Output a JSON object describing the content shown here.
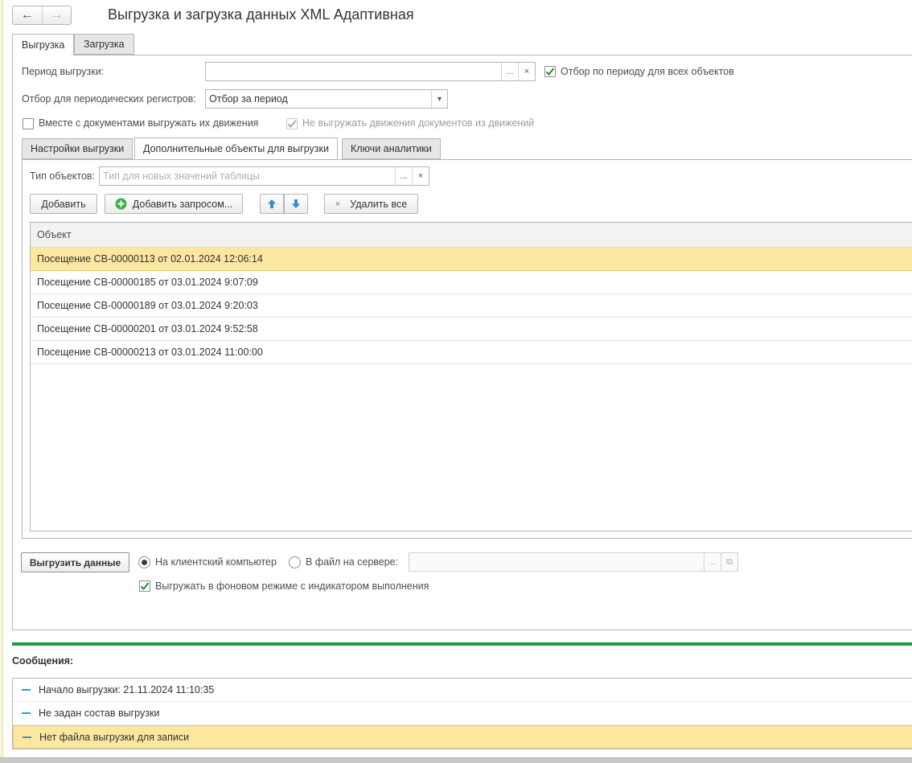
{
  "window": {
    "title": "Выгрузка и загрузка данных XML Адаптивная"
  },
  "nav": {
    "back_icon": "←",
    "forward_icon": "→"
  },
  "tabs": [
    {
      "label": "Выгрузка",
      "active": true
    },
    {
      "label": "Загрузка",
      "active": false
    }
  ],
  "export": {
    "period_label": "Период выгрузки:",
    "period_value": "",
    "period_select_icon": "...",
    "period_clear_icon": "×",
    "period_all_label": "Отбор по периоду для всех объектов",
    "period_all_checked": true,
    "periodic_label": "Отбор для периодических регистров:",
    "periodic_value": "Отбор за период",
    "periodic_dropdown_icon": "▾",
    "with_movements_label": "Вместе с документами выгружать их движения",
    "with_movements_checked": false,
    "no_movements_label": "Не выгружать движения документов из движений",
    "no_movements_checked": true
  },
  "inner_tabs": [
    {
      "label": "Настройки выгрузки",
      "active": false
    },
    {
      "label": "Дополнительные объекты для выгрузки",
      "active": true
    },
    {
      "label": "Ключи аналитики",
      "active": false
    }
  ],
  "objects": {
    "type_label": "Тип объектов:",
    "type_placeholder": "Тип для новых значений таблицы",
    "type_select_icon": "...",
    "type_clear_icon": "×",
    "add_label": "Добавить",
    "add_query_label": "Добавить запросом...",
    "delete_all_label": "Удалить все",
    "delete_icon": "×",
    "column_header": "Объект",
    "rows": [
      "Посещение СВ-00000113 от 02.01.2024 12:06:14",
      "Посещение СВ-00000185 от 03.01.2024 9:07:09",
      "Посещение СВ-00000189 от 03.01.2024 9:20:03",
      "Посещение СВ-00000201 от 03.01.2024 9:52:58",
      "Посещение СВ-00000213 от 03.01.2024 11:00:00"
    ],
    "selected_row": 0
  },
  "run": {
    "export_button": "Выгрузить данные",
    "client_label": "На клиентский компьютер",
    "server_label": "В файл на сервере:",
    "destination": "client",
    "server_path": "",
    "server_select_icon": "...",
    "server_open_icon": "⧉",
    "background_label": "Выгружать в фоновом режиме с индикатором выполнения",
    "background_checked": true
  },
  "messages": {
    "title": "Сообщения:",
    "items": [
      "Начало выгрузки: 21.11.2024 11:10:35",
      "Не задан состав выгрузки",
      "Нет файла выгрузки для записи"
    ],
    "selected_item": 2
  },
  "colors": {
    "accent_green": "#1e9a3c",
    "check_green": "#1e8c3a",
    "selection_yellow": "#fbe7a0",
    "message_dash": "#2aa0c8",
    "arrow_blue": "#2d8fd5"
  }
}
